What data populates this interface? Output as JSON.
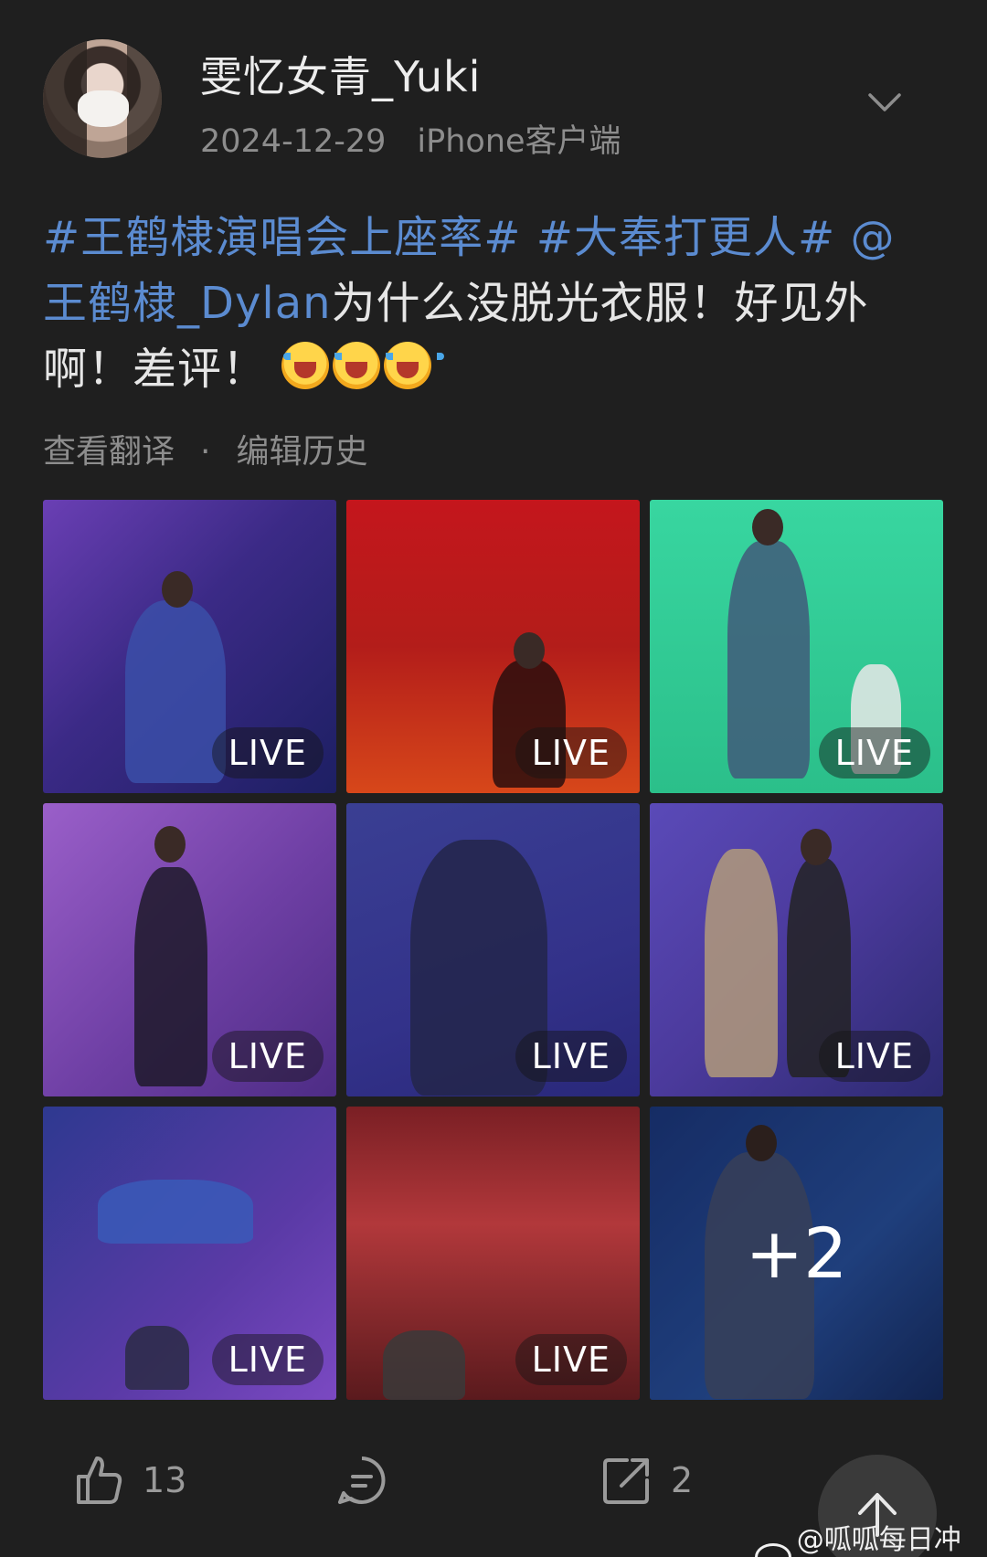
{
  "user": {
    "name": "雯忆女青_Yuki",
    "date": "2024-12-29",
    "client": "iPhone客户端"
  },
  "post": {
    "tag1": "#王鹤棣演唱会上座率#",
    "tag2": "#大奉打更人#",
    "mention": "@王鹤棣_Dylan",
    "text": "为什么没脱光衣服！好见外啊！差评！"
  },
  "actions": {
    "translate": "查看翻译",
    "separator": "·",
    "history": "编辑历史"
  },
  "media": {
    "badge": "LIVE",
    "more": "+2",
    "tiles": [
      {
        "live": true
      },
      {
        "live": true
      },
      {
        "live": true
      },
      {
        "live": true
      },
      {
        "live": true
      },
      {
        "live": true
      },
      {
        "live": true
      },
      {
        "live": true
      },
      {
        "live": false,
        "more": true
      }
    ]
  },
  "footer": {
    "likes": "13",
    "reposts": "2"
  },
  "watermark": "@呱呱每日冲浪",
  "colors": {
    "background": "#1f1f1f",
    "tag": "#5b8bd0",
    "muted": "#8d8d8d"
  }
}
